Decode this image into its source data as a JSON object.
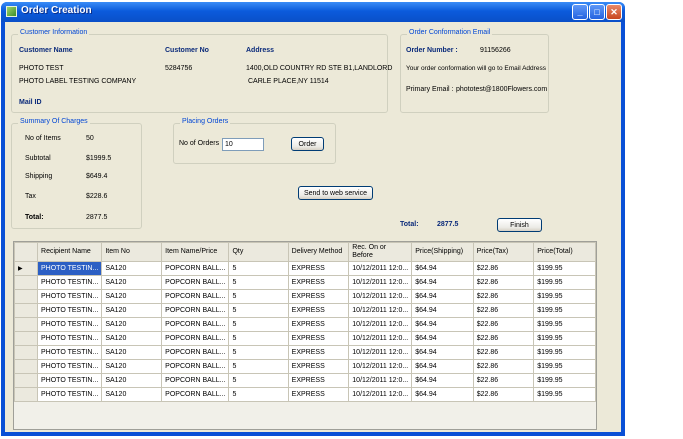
{
  "window": {
    "title": "Order Creation"
  },
  "customer": {
    "group_label": "Customer Information",
    "name_label": "Customer Name",
    "no_label": "Customer No",
    "address_label": "Address",
    "name_line1": "PHOTO   TEST",
    "name_line2": "PHOTO LABEL TESTING COMPANY",
    "number": "5284756",
    "address_line1": "1400,OLD COUNTRY RD STE B1,LANDLORD",
    "address_line2": "CARLE PLACE,NY 11514",
    "mail_label": "Mail ID"
  },
  "confirmation": {
    "group_label": "Order Conformation Email",
    "order_number_label": "Order Number  :",
    "order_number": "91156266",
    "note": "Your order conformation will go to Email Address",
    "primary_email_label": "Primary Email :",
    "primary_email": "phototest@1800Flowers.com"
  },
  "summary": {
    "group_label": "Summary Of Charges",
    "items_label": "No of Items",
    "items": "50",
    "subtotal_label": "Subtotal",
    "subtotal": "$1999.5",
    "shipping_label": "Shipping",
    "shipping": "$649.4",
    "tax_label": "Tax",
    "tax": "$228.6",
    "total_label": "Total:",
    "total": "2877.5"
  },
  "placing": {
    "group_label": "Placing Orders",
    "orders_label": "No of Orders",
    "orders_value": "10",
    "order_button": "Order"
  },
  "send_button": "Send to web service",
  "footer": {
    "total_label": "Total:",
    "total_value": "2877.5",
    "finish_button": "Finish"
  },
  "grid": {
    "row_indicator": "▶",
    "columns": [
      "Recipient Name",
      "Item No",
      "Item Name/Price",
      "Qty",
      "Delivery Method",
      "Rec. On or Before",
      "Price(Shipping)",
      "Price(Tax)",
      "Price(Total)"
    ],
    "rows": [
      [
        "PHOTO TESTIN...",
        "SA120",
        "POPCORN BALL...",
        "5",
        "EXPRESS",
        "10/12/2011 12:0...",
        "$64.94",
        "$22.86",
        "$199.95"
      ],
      [
        "PHOTO TESTIN...",
        "SA120",
        "POPCORN BALL...",
        "5",
        "EXPRESS",
        "10/12/2011 12:0...",
        "$64.94",
        "$22.86",
        "$199.95"
      ],
      [
        "PHOTO TESTIN...",
        "SA120",
        "POPCORN BALL...",
        "5",
        "EXPRESS",
        "10/12/2011 12:0...",
        "$64.94",
        "$22.86",
        "$199.95"
      ],
      [
        "PHOTO TESTIN...",
        "SA120",
        "POPCORN BALL...",
        "5",
        "EXPRESS",
        "10/12/2011 12:0...",
        "$64.94",
        "$22.86",
        "$199.95"
      ],
      [
        "PHOTO TESTIN...",
        "SA120",
        "POPCORN BALL...",
        "5",
        "EXPRESS",
        "10/12/2011 12:0...",
        "$64.94",
        "$22.86",
        "$199.95"
      ],
      [
        "PHOTO TESTIN...",
        "SA120",
        "POPCORN BALL...",
        "5",
        "EXPRESS",
        "10/12/2011 12:0...",
        "$64.94",
        "$22.86",
        "$199.95"
      ],
      [
        "PHOTO TESTIN...",
        "SA120",
        "POPCORN BALL...",
        "5",
        "EXPRESS",
        "10/12/2011 12:0...",
        "$64.94",
        "$22.86",
        "$199.95"
      ],
      [
        "PHOTO TESTIN...",
        "SA120",
        "POPCORN BALL...",
        "5",
        "EXPRESS",
        "10/12/2011 12:0...",
        "$64.94",
        "$22.86",
        "$199.95"
      ],
      [
        "PHOTO TESTIN...",
        "SA120",
        "POPCORN BALL...",
        "5",
        "EXPRESS",
        "10/12/2011 12:0...",
        "$64.94",
        "$22.86",
        "$199.95"
      ],
      [
        "PHOTO TESTIN...",
        "SA120",
        "POPCORN BALL...",
        "5",
        "EXPRESS",
        "10/12/2011 12:0...",
        "$64.94",
        "$22.86",
        "$199.95"
      ]
    ]
  }
}
